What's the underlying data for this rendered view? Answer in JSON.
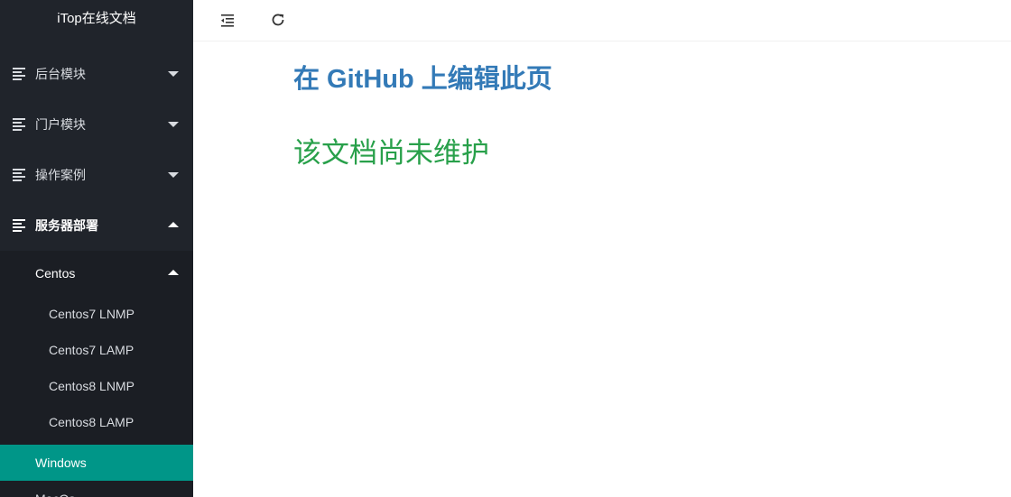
{
  "sidebar": {
    "brand": "iTop在线文档",
    "items": [
      {
        "label": "后台模块",
        "expanded": false
      },
      {
        "label": "门户模块",
        "expanded": false
      },
      {
        "label": "操作案例",
        "expanded": false
      },
      {
        "label": "服务器部署",
        "expanded": true
      }
    ],
    "submenu": {
      "header": "Centos",
      "items": [
        "Centos7 LNMP",
        "Centos7 LAMP",
        "Centos8 LNMP",
        "Centos8 LAMP"
      ],
      "active": "Windows",
      "next": "MacOs"
    }
  },
  "topbar": {
    "icons": [
      "menu-fold-icon",
      "refresh-icon"
    ]
  },
  "main": {
    "edit_link": "在 GitHub 上编辑此页",
    "notice": "该文档尚未维护"
  },
  "colors": {
    "sidebar_bg": "#20242b",
    "submenu_bg": "#1b1e24",
    "active_bg": "#009688",
    "link": "#337ab7",
    "notice": "#28a04a"
  }
}
